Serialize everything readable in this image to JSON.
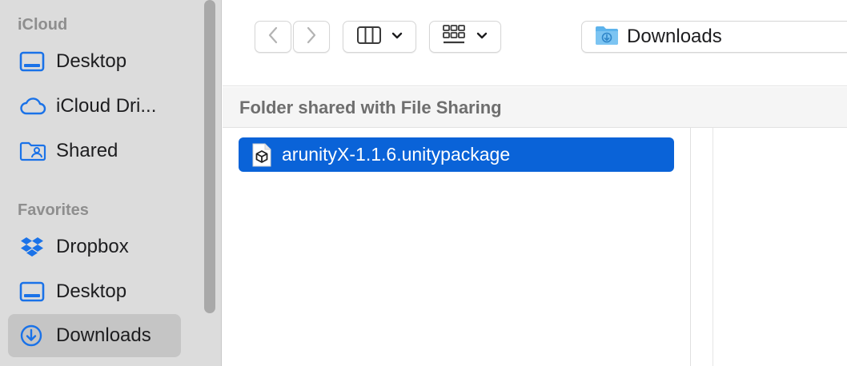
{
  "sidebar": {
    "sections": [
      {
        "title": "iCloud",
        "items": [
          {
            "label": "Desktop",
            "icon": "desktop-icon"
          },
          {
            "label": "iCloud Dri...",
            "icon": "cloud-icon"
          },
          {
            "label": "Shared",
            "icon": "shared-folder-icon"
          }
        ]
      },
      {
        "title": "Favorites",
        "items": [
          {
            "label": "Dropbox",
            "icon": "dropbox-icon"
          },
          {
            "label": "Desktop",
            "icon": "desktop-icon"
          },
          {
            "label": "Downloads",
            "icon": "downloads-icon",
            "selected": true
          }
        ]
      }
    ]
  },
  "toolbar": {
    "path_label": "Downloads",
    "icons": [
      "chevron-left-icon",
      "chevron-right-icon",
      "columns-view-icon",
      "chevron-down-icon",
      "grid-icon",
      "chevron-down-icon",
      "downloads-folder-icon"
    ]
  },
  "header": {
    "title": "Folder shared with File Sharing"
  },
  "files": [
    {
      "name": "arunityX-1.1.6.unitypackage",
      "icon": "unity-package-icon",
      "selected": true
    }
  ],
  "colors": {
    "accent": "#0a63d8",
    "sidebar_bg": "#dcdcdc",
    "selected_item_bg": "#c5c5c5"
  }
}
